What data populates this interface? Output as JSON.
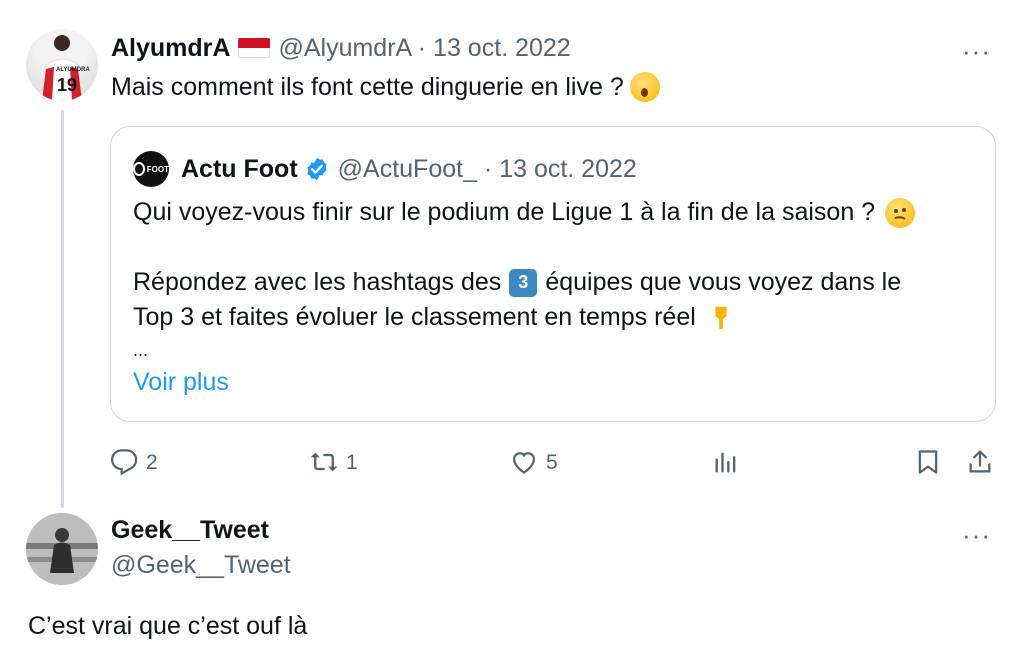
{
  "tweet": {
    "author_name": "AlyumdrA",
    "handle_date": "@AlyumdrA · 13 oct. 2022",
    "text": "Mais comment ils font cette dinguerie en live ?",
    "jersey_number": "19",
    "jersey_name": "ALYUMDRA",
    "more_label": "···"
  },
  "quote": {
    "author_name": "Actu Foot",
    "avatar_text": "FOOT",
    "handle_date": "@ActuFoot_ · 13 oct. 2022",
    "line1": "Qui voyez-vous finir sur le podium de Ligue 1 à la fin de la saison ?",
    "line2_a": "Répondez avec les hashtags des",
    "line2_keycap": "3",
    "line2_b": "équipes que vous voyez dans le",
    "line3": "Top 3 et faites évoluer le classement en temps réel",
    "ellipsis": "...",
    "read_more": "Voir plus"
  },
  "actions": {
    "reply_count": "2",
    "retweet_count": "1",
    "like_count": "5"
  },
  "reply": {
    "author_name": "Geek__Tweet",
    "handle": "@Geek__Tweet",
    "more_label": "···",
    "text": "C’est vrai que c’est ouf là"
  },
  "colors": {
    "accent": "#1d9bf0",
    "muted_text": "#536471",
    "border": "#cfd9de",
    "text": "#0f1419"
  }
}
